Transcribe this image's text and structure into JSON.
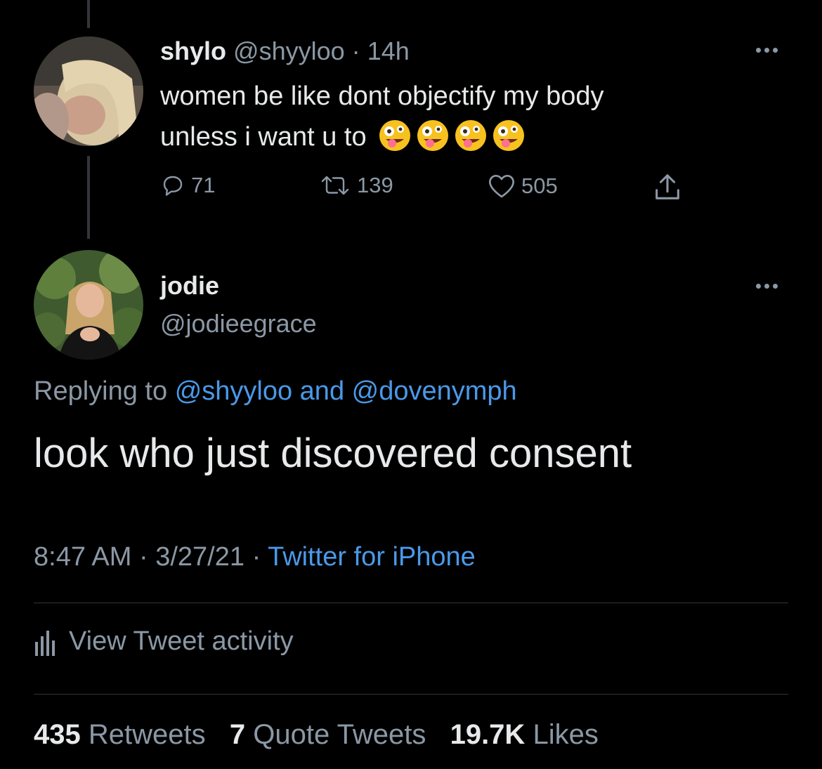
{
  "parent_tweet": {
    "display_name": "shylo",
    "handle": "@shyyloo",
    "separator": "·",
    "time": "14h",
    "text_line1": "women be like dont objectify my body",
    "text_line2": "unless i want u to",
    "emoji": [
      "zany-face",
      "zany-face",
      "zany-face",
      "zany-face"
    ],
    "replies": "71",
    "retweets": "139",
    "likes": "505"
  },
  "main_tweet": {
    "display_name": "jodie",
    "handle": "@jodieegrace",
    "replying_prefix": "Replying to",
    "reply_to_1": "@shyyloo",
    "reply_and": "and",
    "reply_to_2": "@dovenymph",
    "text": "look who just discovered consent",
    "time": "8:47 AM",
    "dot": "·",
    "date": "3/27/21",
    "source": "Twitter for iPhone",
    "activity_label": "View Tweet activity",
    "stats": {
      "retweets_count": "435",
      "retweets_label": "Retweets",
      "quotes_count": "7",
      "quotes_label": "Quote Tweets",
      "likes_count": "19.7K",
      "likes_label": "Likes"
    }
  },
  "colors": {
    "background": "#000000",
    "text": "#e7e9ea",
    "muted": "#8b98a5",
    "link": "#4a99e9",
    "divider": "#2f3336"
  }
}
